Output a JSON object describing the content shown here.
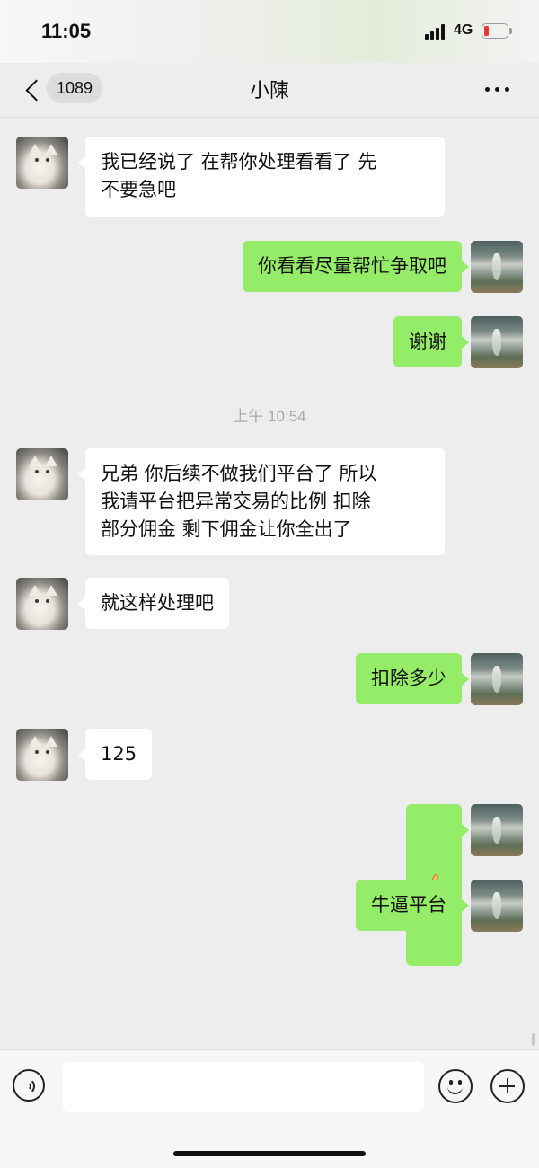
{
  "status_bar": {
    "time": "11:05",
    "network": "4G",
    "battery_level": 0.15,
    "icons": [
      "signal-icon",
      "battery-icon"
    ]
  },
  "nav": {
    "unread_count": "1089",
    "title": "小陳",
    "icons": [
      "back-chevron-icon",
      "more-icon"
    ]
  },
  "messages": [
    {
      "side": "left",
      "text": "我已经说了 在帮你处理看看了 先\n不要急吧"
    },
    {
      "side": "right",
      "text": "你看看尽量帮忙争取吧"
    },
    {
      "side": "right",
      "text": "谢谢"
    },
    {
      "side": "left",
      "text": "兄弟 你后续不做我们平台了 所以\n我请平台把异常交易的比例 扣除\n部分佣金 剩下佣金让你全出了"
    },
    {
      "side": "left",
      "text": "就这样处理吧"
    },
    {
      "side": "right",
      "text": "扣除多少"
    },
    {
      "side": "left",
      "text": "125"
    },
    {
      "side": "right",
      "emoji": "thumbs-up-icon"
    },
    {
      "side": "right",
      "text": "牛逼平台"
    }
  ],
  "timestamp": "上午 10:54",
  "avatars": {
    "contact": "cat-avatar",
    "self": "storm-avatar"
  },
  "colors": {
    "sent_bubble": "#95ec69",
    "received_bubble": "#ffffff",
    "background": "#ededed"
  },
  "input_bar": {
    "placeholder": "",
    "icons": [
      "voice-icon",
      "emoji-icon",
      "plus-icon"
    ]
  }
}
